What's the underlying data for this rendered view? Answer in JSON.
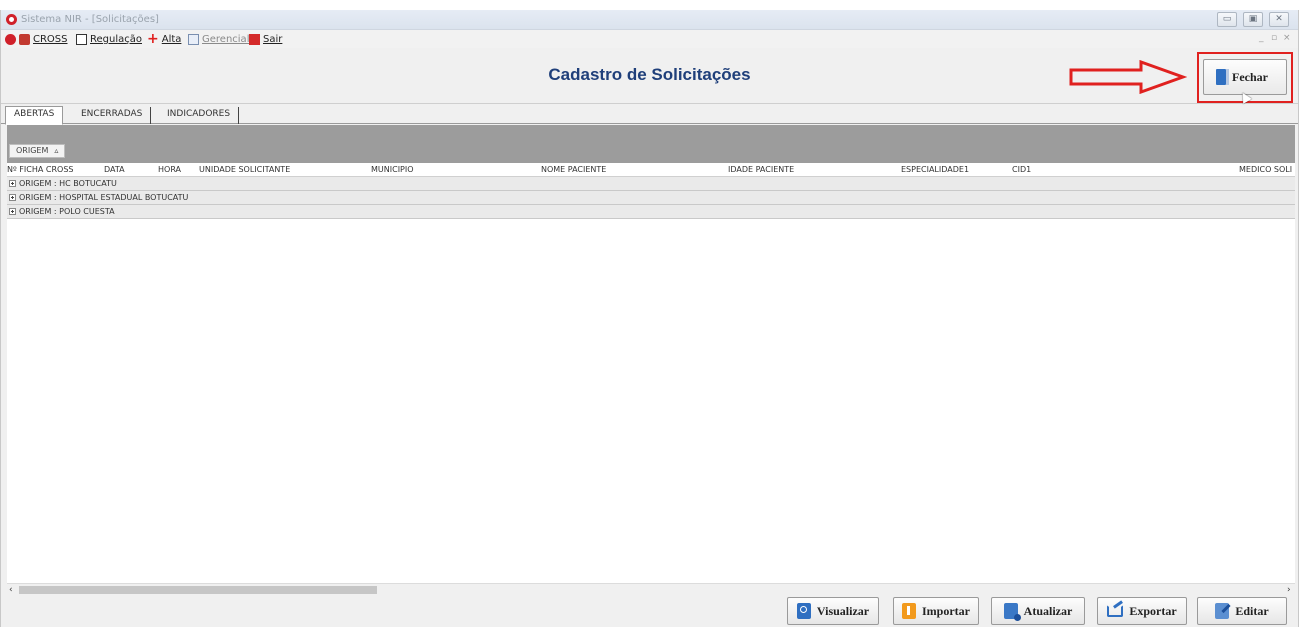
{
  "window": {
    "title": "Sistema NIR - [Solicitações]",
    "controls": [
      "▭",
      "▣",
      "✕"
    ],
    "mdi_controls": [
      "_",
      "▫",
      "×"
    ]
  },
  "menu": {
    "items": [
      {
        "label": "CROSS",
        "icon": "cross-system-icon"
      },
      {
        "label": "Regulação",
        "icon": "regulation-icon"
      },
      {
        "label": "Alta",
        "icon": "red-plus-icon"
      },
      {
        "label": "Gerencial",
        "icon": "report-icon"
      },
      {
        "label": "Sair",
        "icon": "exit-icon"
      }
    ]
  },
  "header": {
    "title": "Cadastro de Solicitações",
    "close_label": "Fechar"
  },
  "tabs": [
    "ABERTAS",
    "ENCERRADAS",
    "INDICADORES"
  ],
  "grouping": {
    "chip_label": "ORIGEM",
    "chip_sort": "▵"
  },
  "columns": [
    "Nº FICHA CROSS",
    "DATA",
    "HORA",
    "UNIDADE SOLICITANTE",
    "MUNICIPIO",
    "NOME PACIENTE",
    "IDADE PACIENTE",
    "ESPECIALIDADE1",
    "CID1",
    "MEDICO SOLI"
  ],
  "groups": [
    "ORIGEM : HC BOTUCATU",
    "ORIGEM : HOSPITAL ESTADUAL BOTUCATU",
    "ORIGEM : POLO CUESTA"
  ],
  "scroll": {
    "left": "‹",
    "right": "›"
  },
  "footer_buttons": [
    "Visualizar",
    "Importar",
    "Atualizar",
    "Exportar",
    "Editar"
  ],
  "colors": {
    "title_blue": "#1f3f7a",
    "highlight_red": "#e0211f",
    "group_band": "#9c9c9c"
  }
}
